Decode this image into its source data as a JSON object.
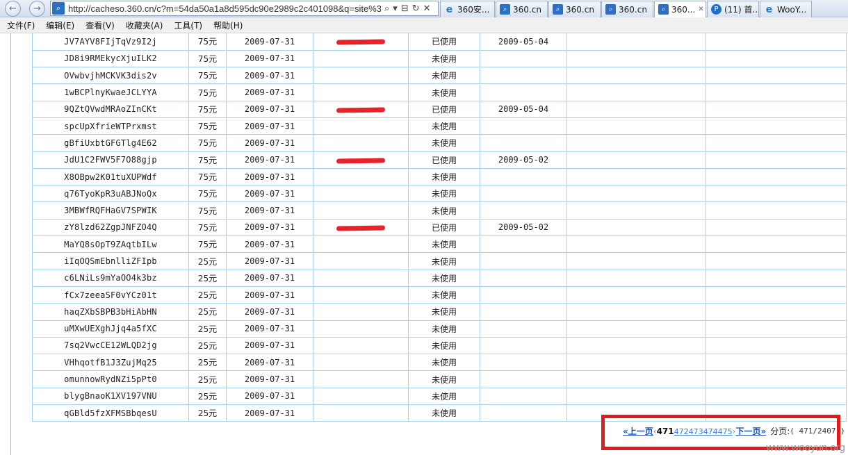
{
  "browser": {
    "back_icon": "back-arrow-icon",
    "forward_icon": "forward-arrow-icon",
    "address_url": "http://cacheso.360.cn/c?m=54da50a1a8d595dc90e2989c2c401098&q=site%3",
    "address_tools": {
      "search": "⌕",
      "dropdown": "▾",
      "compat": "⊟",
      "refresh": "↻",
      "close": "✕"
    },
    "tabs": [
      {
        "label": "360安...",
        "icon": "ie-icon",
        "icon_char": "e",
        "active": false,
        "width": 79
      },
      {
        "label": "360.cn",
        "icon": "search-icon",
        "icon_char": "⌕",
        "active": false,
        "width": 75
      },
      {
        "label": "360.cn",
        "icon": "search-icon",
        "icon_char": "⌕",
        "active": false,
        "width": 75
      },
      {
        "label": "360.cn",
        "icon": "search-icon",
        "icon_char": "⌕",
        "active": false,
        "width": 75
      },
      {
        "label": "360...",
        "icon": "search-icon",
        "icon_char": "⌕",
        "active": true,
        "width": 75
      },
      {
        "label": "(11) 首...",
        "icon": "p-icon",
        "icon_char": "P",
        "active": false,
        "width": 75
      },
      {
        "label": "WooY...",
        "icon": "ie-icon",
        "icon_char": "e",
        "active": false,
        "width": 75
      }
    ]
  },
  "menu": [
    "文件(F)",
    "编辑(E)",
    "查看(V)",
    "收藏夹(A)",
    "工具(T)",
    "帮助(H)"
  ],
  "table": {
    "rows": [
      {
        "code": "JV7AYV8FIjTqVz9I2j",
        "price": "75元",
        "date": "2009-07-31",
        "redacted": true,
        "status": "已使用",
        "used_date": "2009-05-04"
      },
      {
        "code": "JD8i9RMEkycXjuILK2",
        "price": "75元",
        "date": "2009-07-31",
        "redacted": false,
        "status": "未使用",
        "used_date": ""
      },
      {
        "code": "OVwbvjhMCKVK3dis2v",
        "price": "75元",
        "date": "2009-07-31",
        "redacted": false,
        "status": "未使用",
        "used_date": ""
      },
      {
        "code": "1wBCPlnyKwaeJCLYYA",
        "price": "75元",
        "date": "2009-07-31",
        "redacted": false,
        "status": "未使用",
        "used_date": ""
      },
      {
        "code": "9QZtQVwdMRAoZInCKt",
        "price": "75元",
        "date": "2009-07-31",
        "redacted": true,
        "status": "已使用",
        "used_date": "2009-05-04"
      },
      {
        "code": "spcUpXfrieWTPrxmst",
        "price": "75元",
        "date": "2009-07-31",
        "redacted": false,
        "status": "未使用",
        "used_date": ""
      },
      {
        "code": "gBfiUxbtGFGTlg4E62",
        "price": "75元",
        "date": "2009-07-31",
        "redacted": false,
        "status": "未使用",
        "used_date": ""
      },
      {
        "code": "JdU1C2FWV5F7O88gjp",
        "price": "75元",
        "date": "2009-07-31",
        "redacted": true,
        "status": "已使用",
        "used_date": "2009-05-02"
      },
      {
        "code": "X8OBpw2K01tuXUPWdf",
        "price": "75元",
        "date": "2009-07-31",
        "redacted": false,
        "status": "未使用",
        "used_date": ""
      },
      {
        "code": "q76TyoKpR3uABJNoQx",
        "price": "75元",
        "date": "2009-07-31",
        "redacted": false,
        "status": "未使用",
        "used_date": ""
      },
      {
        "code": "3MBWfRQFHaGV7SPWIK",
        "price": "75元",
        "date": "2009-07-31",
        "redacted": false,
        "status": "未使用",
        "used_date": ""
      },
      {
        "code": "zY8lzd62ZgpJNFZO4Q",
        "price": "75元",
        "date": "2009-07-31",
        "redacted": true,
        "status": "已使用",
        "used_date": "2009-05-02"
      },
      {
        "code": "MaYQ8sOpT9ZAqtbILw",
        "price": "75元",
        "date": "2009-07-31",
        "redacted": false,
        "status": "未使用",
        "used_date": ""
      },
      {
        "code": "iIqOQSmEbnlliZFIpb",
        "price": "25元",
        "date": "2009-07-31",
        "redacted": false,
        "status": "未使用",
        "used_date": ""
      },
      {
        "code": "c6LNiLs9mYaOO4k3bz",
        "price": "25元",
        "date": "2009-07-31",
        "redacted": false,
        "status": "未使用",
        "used_date": ""
      },
      {
        "code": "fCx7zeeaSF0vYCz01t",
        "price": "25元",
        "date": "2009-07-31",
        "redacted": false,
        "status": "未使用",
        "used_date": ""
      },
      {
        "code": "haqZXbSBPB3bHiAbHN",
        "price": "25元",
        "date": "2009-07-31",
        "redacted": false,
        "status": "未使用",
        "used_date": ""
      },
      {
        "code": "uMXwUEXghJjq4a5fXC",
        "price": "25元",
        "date": "2009-07-31",
        "redacted": false,
        "status": "未使用",
        "used_date": ""
      },
      {
        "code": "7sq2VwcCE12WLQD2jg",
        "price": "25元",
        "date": "2009-07-31",
        "redacted": false,
        "status": "未使用",
        "used_date": ""
      },
      {
        "code": "VHhqotfB1J3ZujMq25",
        "price": "25元",
        "date": "2009-07-31",
        "redacted": false,
        "status": "未使用",
        "used_date": ""
      },
      {
        "code": "omunnowRydNZi5pPt0",
        "price": "25元",
        "date": "2009-07-31",
        "redacted": false,
        "status": "未使用",
        "used_date": ""
      },
      {
        "code": "blygBnaoK1XV197VNU",
        "price": "25元",
        "date": "2009-07-31",
        "redacted": false,
        "status": "未使用",
        "used_date": ""
      },
      {
        "code": "qGBld5fzXFMSBbqesU",
        "price": "25元",
        "date": "2009-07-31",
        "redacted": false,
        "status": "未使用",
        "used_date": ""
      }
    ]
  },
  "pagination": {
    "prev_label": "«上一页",
    "current_page": "471",
    "other_pages": [
      "472",
      "473",
      "474",
      "475"
    ],
    "next_label": "下一页»",
    "page_label": "分页:",
    "page_count": "( 471/2407 )"
  },
  "colors": {
    "redaction": "#e8222a",
    "highlight_box": "#e21b1b",
    "table_border": "#a9d3e6",
    "link": "#1a4fb5"
  },
  "watermark": "www.wooyun.org"
}
